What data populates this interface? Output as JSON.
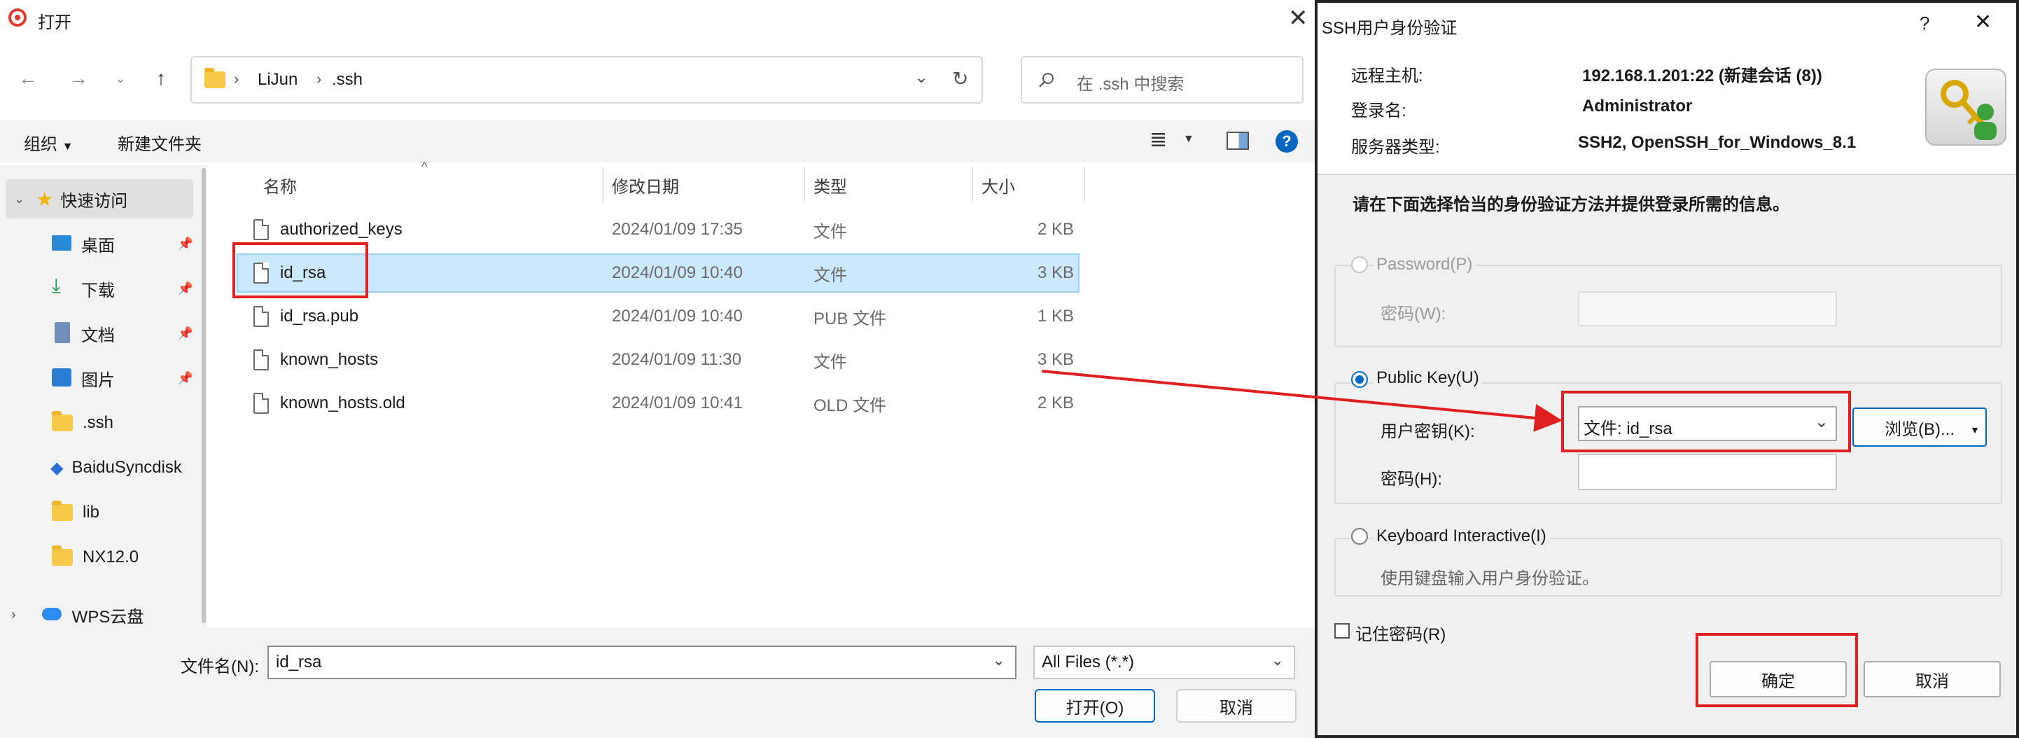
{
  "file_dialog": {
    "title": "打开",
    "address": {
      "crumbs": [
        "LiJun",
        ".ssh"
      ]
    },
    "search_placeholder": "在 .ssh 中搜索",
    "toolbar": {
      "organize": "组织",
      "new_folder": "新建文件夹"
    },
    "nav": [
      {
        "label": "快速访问"
      },
      {
        "label": "桌面"
      },
      {
        "label": "下载"
      },
      {
        "label": "文档"
      },
      {
        "label": "图片"
      },
      {
        "label": ".ssh"
      },
      {
        "label": "BaiduSyncdisk"
      },
      {
        "label": "lib"
      },
      {
        "label": "NX12.0"
      },
      {
        "label": "WPS云盘"
      }
    ],
    "columns": {
      "name": "名称",
      "date": "修改日期",
      "type": "类型",
      "size": "大小"
    },
    "files": [
      {
        "name": "authorized_keys",
        "date": "2024/01/09 17:35",
        "type": "文件",
        "size": "2 KB"
      },
      {
        "name": "id_rsa",
        "date": "2024/01/09 10:40",
        "type": "文件",
        "size": "3 KB"
      },
      {
        "name": "id_rsa.pub",
        "date": "2024/01/09 10:40",
        "type": "PUB 文件",
        "size": "1 KB"
      },
      {
        "name": "known_hosts",
        "date": "2024/01/09 11:30",
        "type": "文件",
        "size": "3 KB"
      },
      {
        "name": "known_hosts.old",
        "date": "2024/01/09 10:41",
        "type": "OLD 文件",
        "size": "2 KB"
      }
    ],
    "filename_label": "文件名(N):",
    "filename_value": "id_rsa",
    "filter_value": "All Files (*.*)",
    "open_button": "打开(O)",
    "cancel_button": "取消"
  },
  "ssh_dialog": {
    "title": "SSH用户身份验证",
    "help_glyph": "?",
    "rows": [
      {
        "label": "远程主机:",
        "value": "192.168.1.201:22 (新建会话 (8))"
      },
      {
        "label": "登录名:",
        "value": "Administrator"
      },
      {
        "label": "服务器类型:",
        "value": "SSH2, OpenSSH_for_Windows_8.1"
      }
    ],
    "instruction": "请在下面选择恰当的身份验证方法并提供登录所需的信息。",
    "password_option": "Password(P)",
    "password_field_label": "密码(W):",
    "pubkey_option": "Public Key(U)",
    "user_key_label": "用户密钥(K):",
    "user_key_value": "文件: id_rsa",
    "browse_button": "浏览(B)...",
    "passphrase_label": "密码(H):",
    "kbd_option": "Keyboard Interactive(I)",
    "kbd_desc": "使用键盘输入用户身份验证。",
    "remember_label": "记住密码(R)",
    "ok_button": "确定",
    "cancel_button": "取消"
  },
  "colors": {
    "accent": "#0067c0",
    "selection": "#cce8ff",
    "highlight": "#e02020"
  }
}
